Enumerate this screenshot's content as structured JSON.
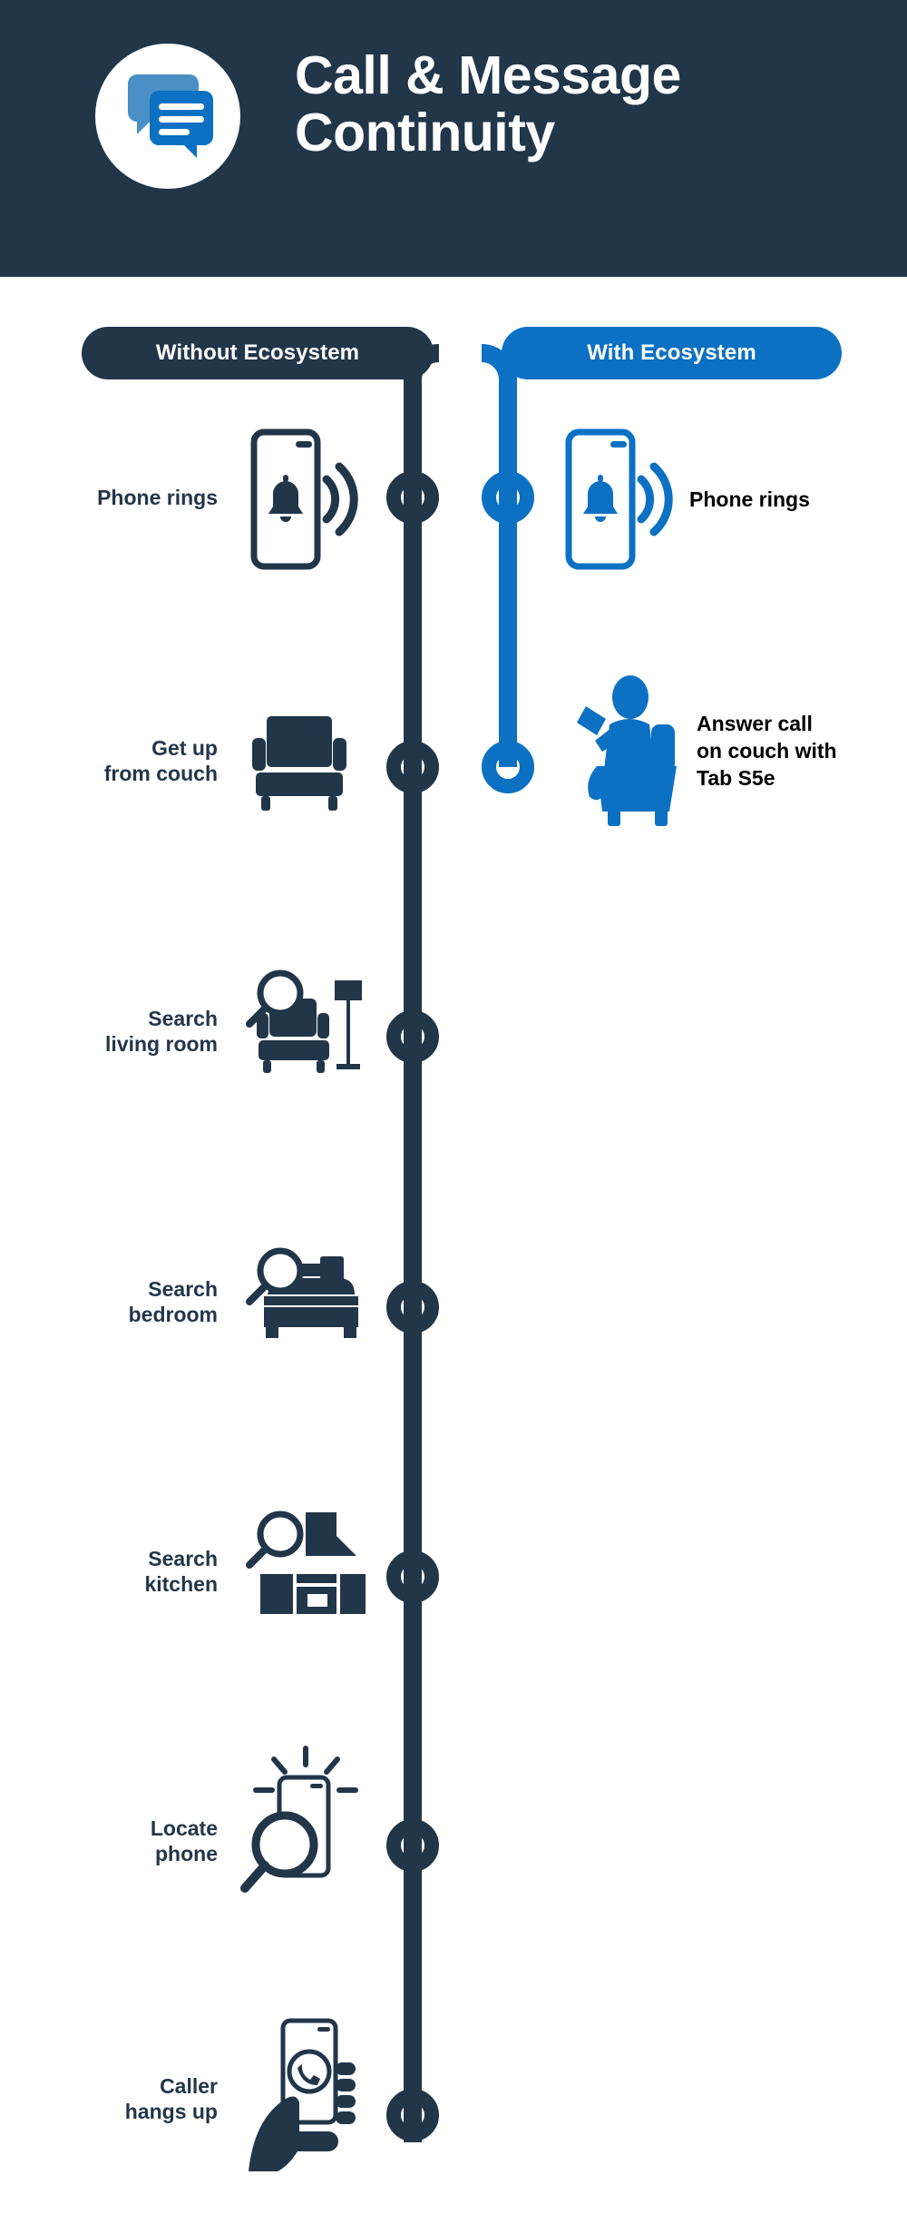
{
  "header": {
    "title_line1": "Call & Message",
    "title_line2": "Continuity",
    "logo_icon": "chat-bubbles-icon",
    "background_color": "#22364a",
    "logo_circle_color": "#ffffff",
    "bubble_back_color": "#4a90c7",
    "bubble_front_color": "#0c71c3"
  },
  "colors": {
    "dark_navy": "#22364a",
    "brand_blue": "#0c71c3",
    "light_blue": "#4a90c7",
    "page_background": "#ffffff",
    "label_left": "#22364a",
    "label_right": "#000000"
  },
  "columns": {
    "left": {
      "label": "Without Ecosystem",
      "color": "#22364a"
    },
    "right": {
      "label": "With Ecosystem",
      "color": "#0c71c3"
    }
  },
  "left_steps": [
    {
      "label_line1": "Phone rings",
      "label_line2": "",
      "icon": "phone-ringing-bell-icon"
    },
    {
      "label_line1": "Get up",
      "label_line2": "from couch",
      "icon": "couch-icon"
    },
    {
      "label_line1": "Search",
      "label_line2": "living room",
      "icon": "search-living-room-icon"
    },
    {
      "label_line1": "Search",
      "label_line2": "bedroom",
      "icon": "search-bedroom-icon"
    },
    {
      "label_line1": "Search",
      "label_line2": "kitchen",
      "icon": "search-kitchen-icon"
    },
    {
      "label_line1": "Locate",
      "label_line2": "phone",
      "icon": "locate-phone-magnifier-icon"
    },
    {
      "label_line1": "Caller",
      "label_line2": "hangs up",
      "icon": "hand-holding-phone-icon"
    }
  ],
  "right_steps": [
    {
      "label_line1": "Phone rings",
      "label_line2": "",
      "label_line3": "",
      "icon": "phone-ringing-bell-blue-icon"
    },
    {
      "label_line1": "Answer call",
      "label_line2": "on couch with",
      "label_line3": "Tab S5e",
      "icon": "person-on-couch-tablet-icon"
    }
  ]
}
